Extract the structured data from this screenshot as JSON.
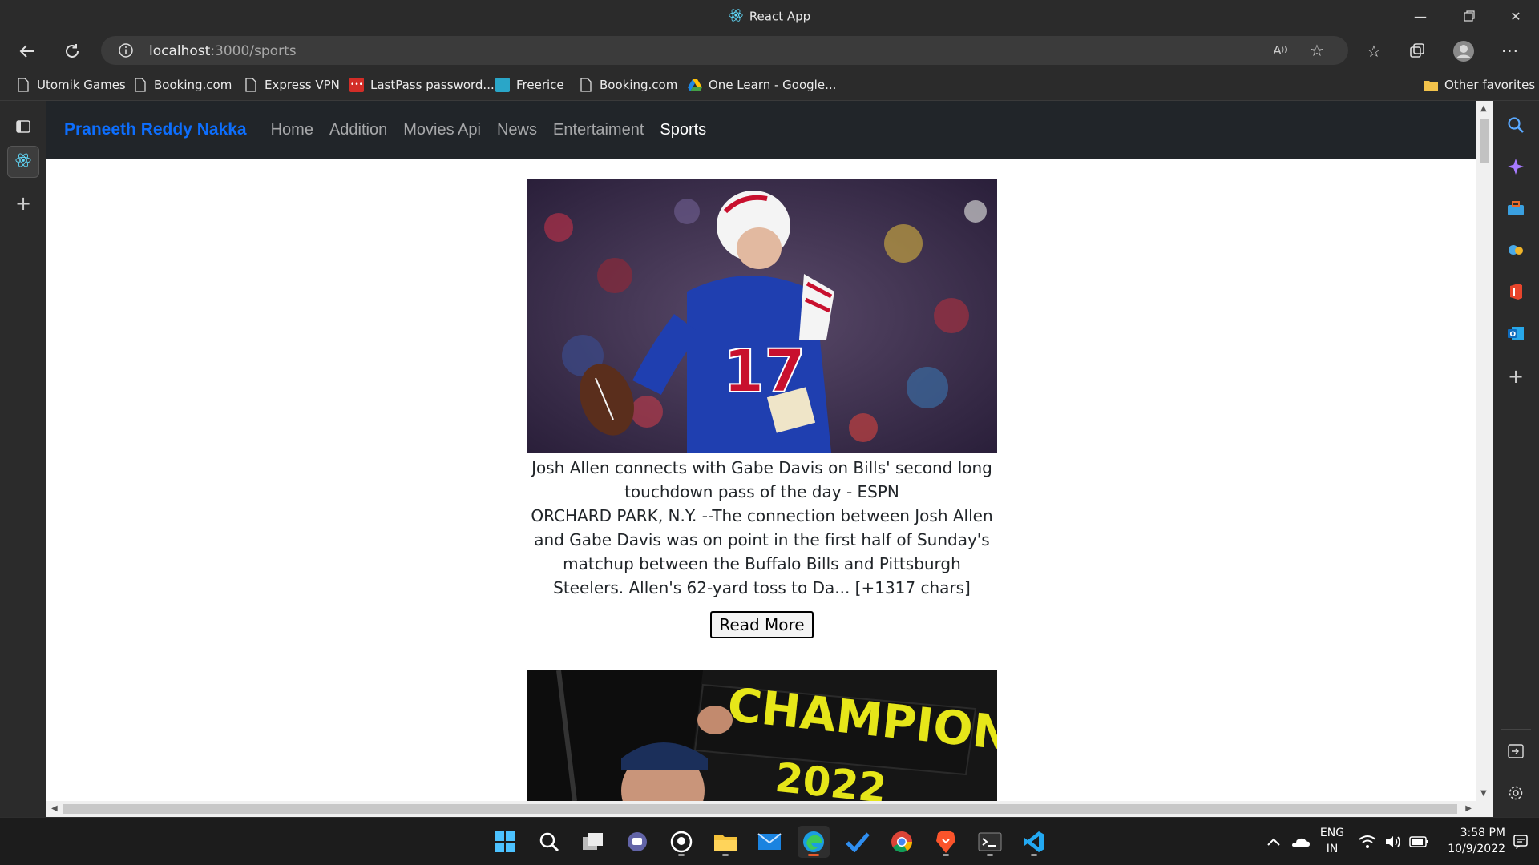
{
  "window": {
    "title": "React App",
    "icons": [
      "react-logo-icon",
      "minimize-icon",
      "maximize-icon",
      "close-icon"
    ]
  },
  "address_bar": {
    "host": "localhost",
    "path": ":3000/sports"
  },
  "favorites": {
    "items": [
      {
        "label": "Utomik Games",
        "icon": "page-icon"
      },
      {
        "label": "Booking.com",
        "icon": "page-icon"
      },
      {
        "label": "Express VPN",
        "icon": "page-icon"
      },
      {
        "label": "LastPass password...",
        "icon": "lastpass-icon"
      },
      {
        "label": "Freerice",
        "icon": "freerice-icon"
      },
      {
        "label": "Booking.com",
        "icon": "page-icon"
      },
      {
        "label": "One Learn - Google...",
        "icon": "google-drive-icon"
      }
    ],
    "other": "Other favorites"
  },
  "app": {
    "brand": "Praneeth Reddy Nakka",
    "nav": [
      {
        "label": "Home",
        "active": false
      },
      {
        "label": "Addition",
        "active": false
      },
      {
        "label": "Movies Api",
        "active": false
      },
      {
        "label": "News",
        "active": false
      },
      {
        "label": "Entertaiment",
        "active": false
      },
      {
        "label": "Sports",
        "active": true
      }
    ],
    "articles": [
      {
        "headline": "Josh Allen connects with Gabe Davis on Bills' second long touchdown pass of the day - ESPN",
        "description": "ORCHARD PARK, N.Y. --The connection between Josh Allen and Gabe Davis was on point in the first half of Sunday's matchup between the Buffalo Bills and Pittsburgh Steelers. Allen's 62-yard toss to Da... [+1317 chars]",
        "button": "Read More",
        "jersey_number": "17"
      },
      {
        "sign_text": "CHAMPION",
        "sign_subtext": "2022"
      }
    ]
  },
  "tray": {
    "lang": "ENG",
    "region": "IN",
    "time": "3:58 PM",
    "date": "10/9/2022"
  },
  "colors": {
    "brand": "#0d6efd",
    "navbar": "#212529",
    "bills_blue": "#1f3fb0",
    "bills_red": "#c8102e",
    "sign_yellow": "#e6e619"
  }
}
